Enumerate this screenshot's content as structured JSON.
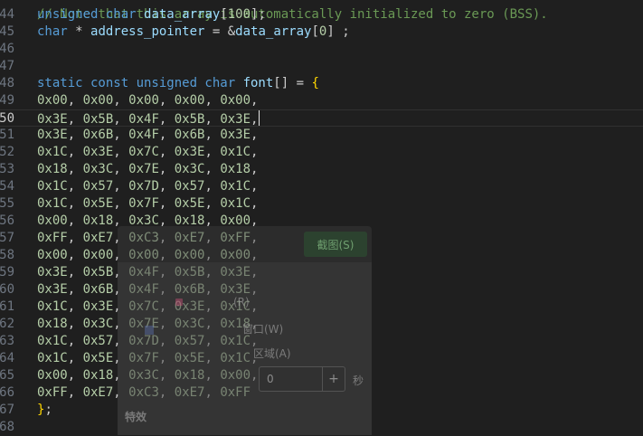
{
  "editor": {
    "top_partial_line": "// Note that this array is automatically initialized to zero (BSS).",
    "lines": [
      {
        "num": "44",
        "parts": [
          [
            "tp",
            "unsigned char "
          ],
          [
            "var",
            "data_array"
          ],
          [
            "plain",
            "["
          ],
          [
            "num",
            "100"
          ],
          [
            "plain",
            "];"
          ]
        ]
      },
      {
        "num": "45",
        "parts": [
          [
            "tp",
            "char"
          ],
          [
            "plain",
            " * "
          ],
          [
            "var",
            "address_pointer"
          ],
          [
            "plain",
            " = &"
          ],
          [
            "var",
            "data_array"
          ],
          [
            "plain",
            "["
          ],
          [
            "num",
            "0"
          ],
          [
            "plain",
            "] ;"
          ]
        ]
      },
      {
        "num": "46",
        "parts": []
      },
      {
        "num": "47",
        "parts": []
      },
      {
        "num": "48",
        "parts": [
          [
            "kw",
            "static const unsigned char "
          ],
          [
            "var",
            "font"
          ],
          [
            "plain",
            "[] = "
          ],
          [
            "brk",
            "{"
          ]
        ]
      },
      {
        "num": "49",
        "parts": [
          [
            "num",
            "0x00"
          ],
          [
            "plain",
            ", "
          ],
          [
            "num",
            "0x00"
          ],
          [
            "plain",
            ", "
          ],
          [
            "num",
            "0x00"
          ],
          [
            "plain",
            ", "
          ],
          [
            "num",
            "0x00"
          ],
          [
            "plain",
            ", "
          ],
          [
            "num",
            "0x00"
          ],
          [
            "plain",
            ","
          ]
        ]
      },
      {
        "num": "50",
        "parts": [
          [
            "num",
            "0x3E"
          ],
          [
            "plain",
            ", "
          ],
          [
            "num",
            "0x5B"
          ],
          [
            "plain",
            ", "
          ],
          [
            "num",
            "0x4F"
          ],
          [
            "plain",
            ", "
          ],
          [
            "num",
            "0x5B"
          ],
          [
            "plain",
            ", "
          ],
          [
            "num",
            "0x3E"
          ],
          [
            "plain",
            ","
          ]
        ]
      },
      {
        "num": "51",
        "parts": [
          [
            "num",
            "0x3E"
          ],
          [
            "plain",
            ", "
          ],
          [
            "num",
            "0x6B"
          ],
          [
            "plain",
            ", "
          ],
          [
            "num",
            "0x4F"
          ],
          [
            "plain",
            ", "
          ],
          [
            "num",
            "0x6B"
          ],
          [
            "plain",
            ", "
          ],
          [
            "num",
            "0x3E"
          ],
          [
            "plain",
            ","
          ]
        ]
      },
      {
        "num": "52",
        "parts": [
          [
            "num",
            "0x1C"
          ],
          [
            "plain",
            ", "
          ],
          [
            "num",
            "0x3E"
          ],
          [
            "plain",
            ", "
          ],
          [
            "num",
            "0x7C"
          ],
          [
            "plain",
            ", "
          ],
          [
            "num",
            "0x3E"
          ],
          [
            "plain",
            ", "
          ],
          [
            "num",
            "0x1C"
          ],
          [
            "plain",
            ","
          ]
        ]
      },
      {
        "num": "53",
        "parts": [
          [
            "num",
            "0x18"
          ],
          [
            "plain",
            ", "
          ],
          [
            "num",
            "0x3C"
          ],
          [
            "plain",
            ", "
          ],
          [
            "num",
            "0x7E"
          ],
          [
            "plain",
            ", "
          ],
          [
            "num",
            "0x3C"
          ],
          [
            "plain",
            ", "
          ],
          [
            "num",
            "0x18"
          ],
          [
            "plain",
            ","
          ]
        ]
      },
      {
        "num": "54",
        "parts": [
          [
            "num",
            "0x1C"
          ],
          [
            "plain",
            ", "
          ],
          [
            "num",
            "0x57"
          ],
          [
            "plain",
            ", "
          ],
          [
            "num",
            "0x7D"
          ],
          [
            "plain",
            ", "
          ],
          [
            "num",
            "0x57"
          ],
          [
            "plain",
            ", "
          ],
          [
            "num",
            "0x1C"
          ],
          [
            "plain",
            ","
          ]
        ]
      },
      {
        "num": "55",
        "parts": [
          [
            "num",
            "0x1C"
          ],
          [
            "plain",
            ", "
          ],
          [
            "num",
            "0x5E"
          ],
          [
            "plain",
            ", "
          ],
          [
            "num",
            "0x7F"
          ],
          [
            "plain",
            ", "
          ],
          [
            "num",
            "0x5E"
          ],
          [
            "plain",
            ", "
          ],
          [
            "num",
            "0x1C"
          ],
          [
            "plain",
            ","
          ]
        ]
      },
      {
        "num": "56",
        "parts": [
          [
            "num",
            "0x00"
          ],
          [
            "plain",
            ", "
          ],
          [
            "num",
            "0x18"
          ],
          [
            "plain",
            ", "
          ],
          [
            "num",
            "0x3C"
          ],
          [
            "plain",
            ", "
          ],
          [
            "num",
            "0x18"
          ],
          [
            "plain",
            ", "
          ],
          [
            "num",
            "0x00"
          ],
          [
            "plain",
            ","
          ]
        ]
      },
      {
        "num": "57",
        "parts": [
          [
            "num",
            "0xFF"
          ],
          [
            "plain",
            ", "
          ],
          [
            "num",
            "0xE7"
          ],
          [
            "plain",
            ", "
          ],
          [
            "num",
            "0xC3"
          ],
          [
            "plain",
            ", "
          ],
          [
            "num",
            "0xE7"
          ],
          [
            "plain",
            ", "
          ],
          [
            "num",
            "0xFF"
          ],
          [
            "plain",
            ","
          ]
        ]
      },
      {
        "num": "58",
        "parts": [
          [
            "num",
            "0x00"
          ],
          [
            "plain",
            ", "
          ],
          [
            "num",
            "0x00"
          ],
          [
            "plain",
            ", "
          ],
          [
            "num",
            "0x00"
          ],
          [
            "plain",
            ", "
          ],
          [
            "num",
            "0x00"
          ],
          [
            "plain",
            ", "
          ],
          [
            "num",
            "0x00"
          ],
          [
            "plain",
            ","
          ]
        ]
      },
      {
        "num": "59",
        "parts": [
          [
            "num",
            "0x3E"
          ],
          [
            "plain",
            ", "
          ],
          [
            "num",
            "0x5B"
          ],
          [
            "plain",
            ", "
          ],
          [
            "num",
            "0x4F"
          ],
          [
            "plain",
            ", "
          ],
          [
            "num",
            "0x5B"
          ],
          [
            "plain",
            ", "
          ],
          [
            "num",
            "0x3E"
          ],
          [
            "plain",
            ","
          ]
        ]
      },
      {
        "num": "60",
        "parts": [
          [
            "num",
            "0x3E"
          ],
          [
            "plain",
            ", "
          ],
          [
            "num",
            "0x6B"
          ],
          [
            "plain",
            ", "
          ],
          [
            "num",
            "0x4F"
          ],
          [
            "plain",
            ", "
          ],
          [
            "num",
            "0x6B"
          ],
          [
            "plain",
            ", "
          ],
          [
            "num",
            "0x3E"
          ],
          [
            "plain",
            ","
          ]
        ]
      },
      {
        "num": "61",
        "parts": [
          [
            "num",
            "0x1C"
          ],
          [
            "plain",
            ", "
          ],
          [
            "num",
            "0x3E"
          ],
          [
            "plain",
            ", "
          ],
          [
            "num",
            "0x7C"
          ],
          [
            "plain",
            ", "
          ],
          [
            "num",
            "0x3E"
          ],
          [
            "plain",
            ", "
          ],
          [
            "num",
            "0x1C"
          ],
          [
            "plain",
            ","
          ]
        ]
      },
      {
        "num": "62",
        "parts": [
          [
            "num",
            "0x18"
          ],
          [
            "plain",
            ", "
          ],
          [
            "num",
            "0x3C"
          ],
          [
            "plain",
            ", "
          ],
          [
            "num",
            "0x7E"
          ],
          [
            "plain",
            ", "
          ],
          [
            "num",
            "0x3C"
          ],
          [
            "plain",
            ", "
          ],
          [
            "num",
            "0x18"
          ],
          [
            "plain",
            ","
          ]
        ]
      },
      {
        "num": "63",
        "parts": [
          [
            "num",
            "0x1C"
          ],
          [
            "plain",
            ", "
          ],
          [
            "num",
            "0x57"
          ],
          [
            "plain",
            ", "
          ],
          [
            "num",
            "0x7D"
          ],
          [
            "plain",
            ", "
          ],
          [
            "num",
            "0x57"
          ],
          [
            "plain",
            ", "
          ],
          [
            "num",
            "0x1C"
          ],
          [
            "plain",
            ","
          ]
        ]
      },
      {
        "num": "64",
        "parts": [
          [
            "num",
            "0x1C"
          ],
          [
            "plain",
            ", "
          ],
          [
            "num",
            "0x5E"
          ],
          [
            "plain",
            ", "
          ],
          [
            "num",
            "0x7F"
          ],
          [
            "plain",
            ", "
          ],
          [
            "num",
            "0x5E"
          ],
          [
            "plain",
            ", "
          ],
          [
            "num",
            "0x1C"
          ],
          [
            "plain",
            ","
          ]
        ]
      },
      {
        "num": "65",
        "parts": [
          [
            "num",
            "0x00"
          ],
          [
            "plain",
            ", "
          ],
          [
            "num",
            "0x18"
          ],
          [
            "plain",
            ", "
          ],
          [
            "num",
            "0x3C"
          ],
          [
            "plain",
            ", "
          ],
          [
            "num",
            "0x18"
          ],
          [
            "plain",
            ", "
          ],
          [
            "num",
            "0x00"
          ],
          [
            "plain",
            ","
          ]
        ]
      },
      {
        "num": "66",
        "parts": [
          [
            "num",
            "0xFF"
          ],
          [
            "plain",
            ", "
          ],
          [
            "num",
            "0xE7"
          ],
          [
            "plain",
            ", "
          ],
          [
            "num",
            "0xC3"
          ],
          [
            "plain",
            ", "
          ],
          [
            "num",
            "0xE7"
          ],
          [
            "plain",
            ", "
          ],
          [
            "num",
            "0xFF"
          ]
        ]
      },
      {
        "num": "67",
        "parts": [
          [
            "brk",
            "}"
          ],
          [
            "plain",
            ";"
          ]
        ]
      },
      {
        "num": "68",
        "parts": []
      }
    ],
    "current_line": "50",
    "colors": {
      "background": "#1f1f1f",
      "keyword": "#569cd6",
      "identifier": "#9cdcfe",
      "number": "#b5cea8",
      "bracket": "#ffd700"
    }
  },
  "overlay": {
    "screenshot_button": "截图(S)",
    "window_option": "窗口(W)",
    "region_option": "区域(A)",
    "r_option": "(R)",
    "delay_unit": "秒",
    "delay_value": "0",
    "effects_label": "特效",
    "plus_icon": "+"
  }
}
